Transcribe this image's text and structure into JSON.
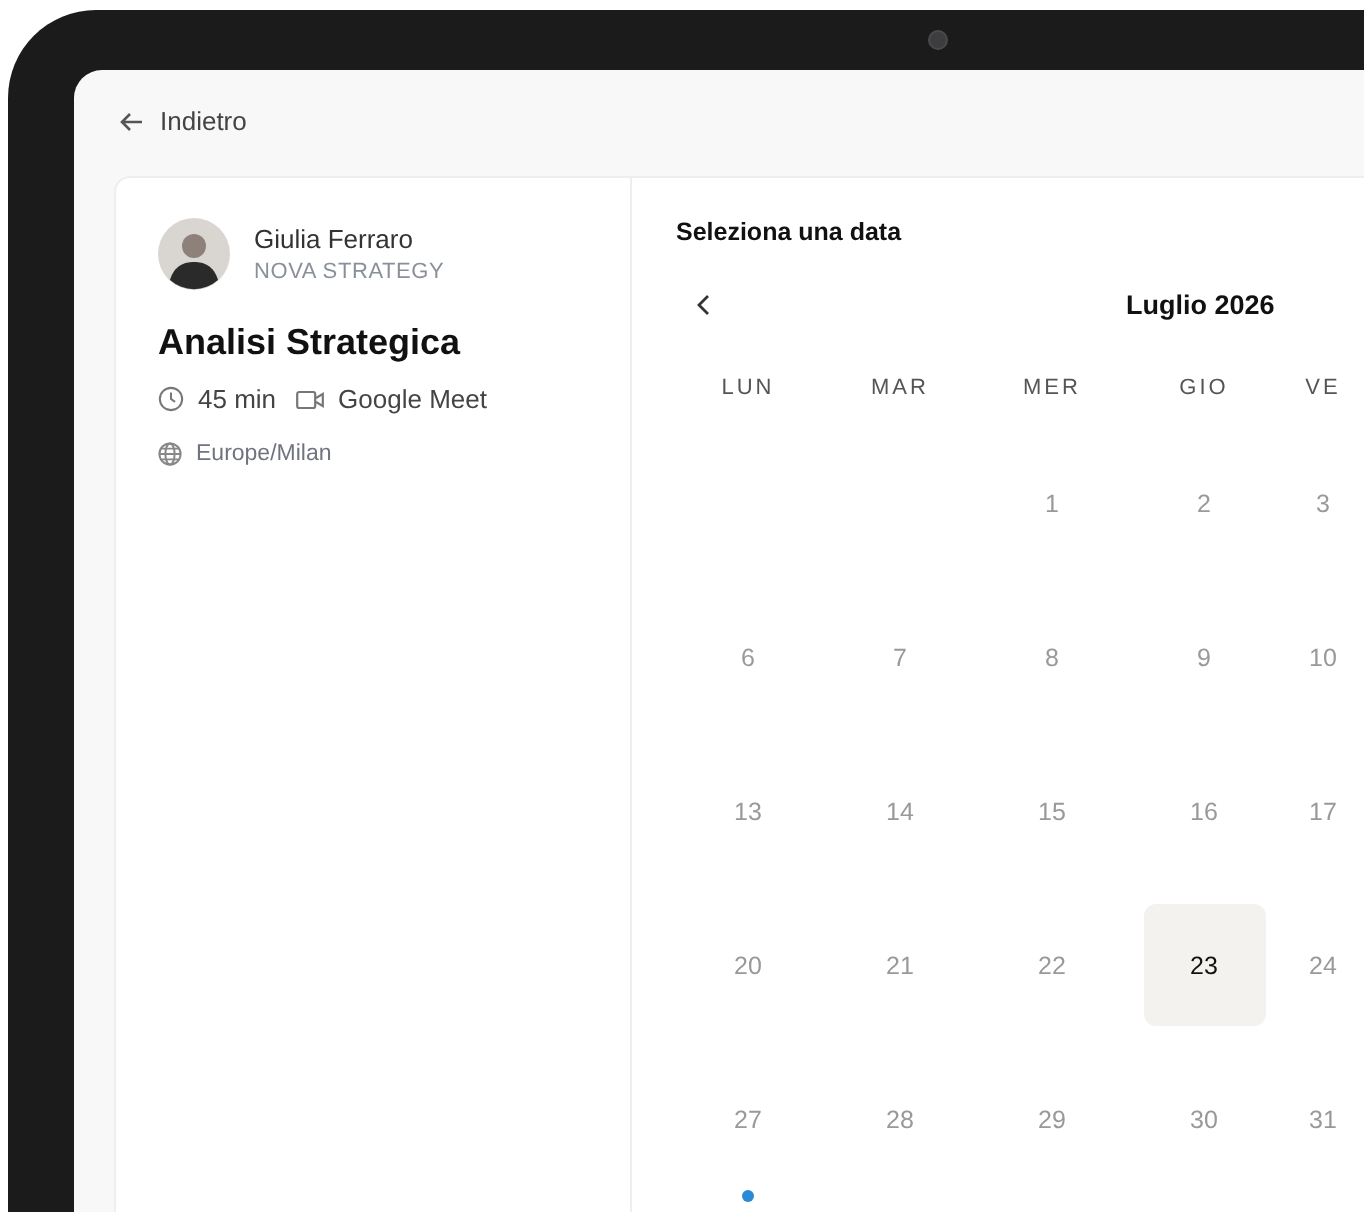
{
  "back": {
    "label": "Indietro"
  },
  "host": {
    "name": "Giulia Ferraro",
    "company": "NOVA STRATEGY"
  },
  "event": {
    "title": "Analisi Strategica",
    "duration": "45 min",
    "location": "Google Meet",
    "timezone": "Europe/Milan"
  },
  "calendar": {
    "heading": "Seleziona una data",
    "month": "Luglio 2026",
    "weekdays": [
      "LUN",
      "MAR",
      "MER",
      "GIO",
      "VE"
    ],
    "weeks": [
      {
        "right_aligned": true,
        "days": [
          {
            "label": "1",
            "selected": false,
            "today": false
          },
          {
            "label": "2",
            "selected": false,
            "today": false
          },
          {
            "label": "3",
            "selected": false,
            "today": false
          }
        ]
      },
      {
        "right_aligned": false,
        "days": [
          {
            "label": "6",
            "selected": false,
            "today": false
          },
          {
            "label": "7",
            "selected": false,
            "today": false
          },
          {
            "label": "8",
            "selected": false,
            "today": false
          },
          {
            "label": "9",
            "selected": false,
            "today": false
          },
          {
            "label": "10",
            "selected": false,
            "today": false
          }
        ]
      },
      {
        "right_aligned": false,
        "days": [
          {
            "label": "13",
            "selected": false,
            "today": false
          },
          {
            "label": "14",
            "selected": false,
            "today": false
          },
          {
            "label": "15",
            "selected": false,
            "today": false
          },
          {
            "label": "16",
            "selected": false,
            "today": false
          },
          {
            "label": "17",
            "selected": false,
            "today": false
          }
        ]
      },
      {
        "right_aligned": false,
        "days": [
          {
            "label": "20",
            "selected": false,
            "today": false
          },
          {
            "label": "21",
            "selected": false,
            "today": false
          },
          {
            "label": "22",
            "selected": false,
            "today": false
          },
          {
            "label": "23",
            "selected": true,
            "today": false
          },
          {
            "label": "24",
            "selected": false,
            "today": false
          }
        ]
      },
      {
        "right_aligned": false,
        "days": [
          {
            "label": "27",
            "selected": false,
            "today": true
          },
          {
            "label": "28",
            "selected": false,
            "today": false
          },
          {
            "label": "29",
            "selected": false,
            "today": false
          },
          {
            "label": "30",
            "selected": false,
            "today": false
          },
          {
            "label": "31",
            "selected": false,
            "today": false
          }
        ]
      }
    ]
  }
}
